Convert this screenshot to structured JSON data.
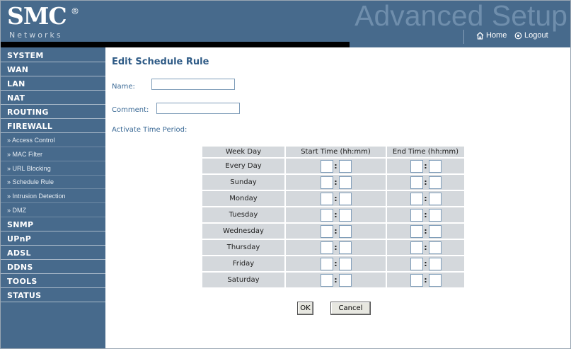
{
  "header": {
    "logo_text": "SMC",
    "logo_reg": "®",
    "logo_sub": "Networks",
    "title": "Advanced Setup",
    "home_label": "Home",
    "logout_label": "Logout"
  },
  "colors": {
    "header_bg": "#476a8c",
    "sidebar_bg": "#476a8c",
    "title_text": "#2f5b86",
    "cell_bg": "#d4d8dc"
  },
  "sidebar": {
    "items": [
      {
        "label": "SYSTEM",
        "type": "main"
      },
      {
        "label": "WAN",
        "type": "main"
      },
      {
        "label": "LAN",
        "type": "main"
      },
      {
        "label": "NAT",
        "type": "main"
      },
      {
        "label": "ROUTING",
        "type": "main"
      },
      {
        "label": "FIREWALL",
        "type": "main"
      },
      {
        "label": "» Access Control",
        "type": "sub"
      },
      {
        "label": "» MAC Filter",
        "type": "sub"
      },
      {
        "label": "» URL Blocking",
        "type": "sub"
      },
      {
        "label": "» Schedule Rule",
        "type": "sub"
      },
      {
        "label": "» Intrusion Detection",
        "type": "sub"
      },
      {
        "label": "» DMZ",
        "type": "sub"
      },
      {
        "label": "SNMP",
        "type": "main"
      },
      {
        "label": "UPnP",
        "type": "main"
      },
      {
        "label": "ADSL",
        "type": "main"
      },
      {
        "label": "DDNS",
        "type": "main"
      },
      {
        "label": "TOOLS",
        "type": "main"
      },
      {
        "label": "STATUS",
        "type": "main"
      }
    ]
  },
  "main": {
    "title": "Edit Schedule Rule",
    "name_label": "Name:",
    "name_value": "",
    "comment_label": "Comment:",
    "comment_value": "",
    "activate_label": "Activate Time Period:",
    "table": {
      "headers": [
        "Week Day",
        "Start Time (hh:mm)",
        "End Time (hh:mm)"
      ],
      "rows": [
        "Every Day",
        "Sunday",
        "Monday",
        "Tuesday",
        "Wednesday",
        "Thursday",
        "Friday",
        "Saturday"
      ],
      "colon": ":"
    },
    "ok_label": "OK",
    "cancel_label": "Cancel"
  }
}
